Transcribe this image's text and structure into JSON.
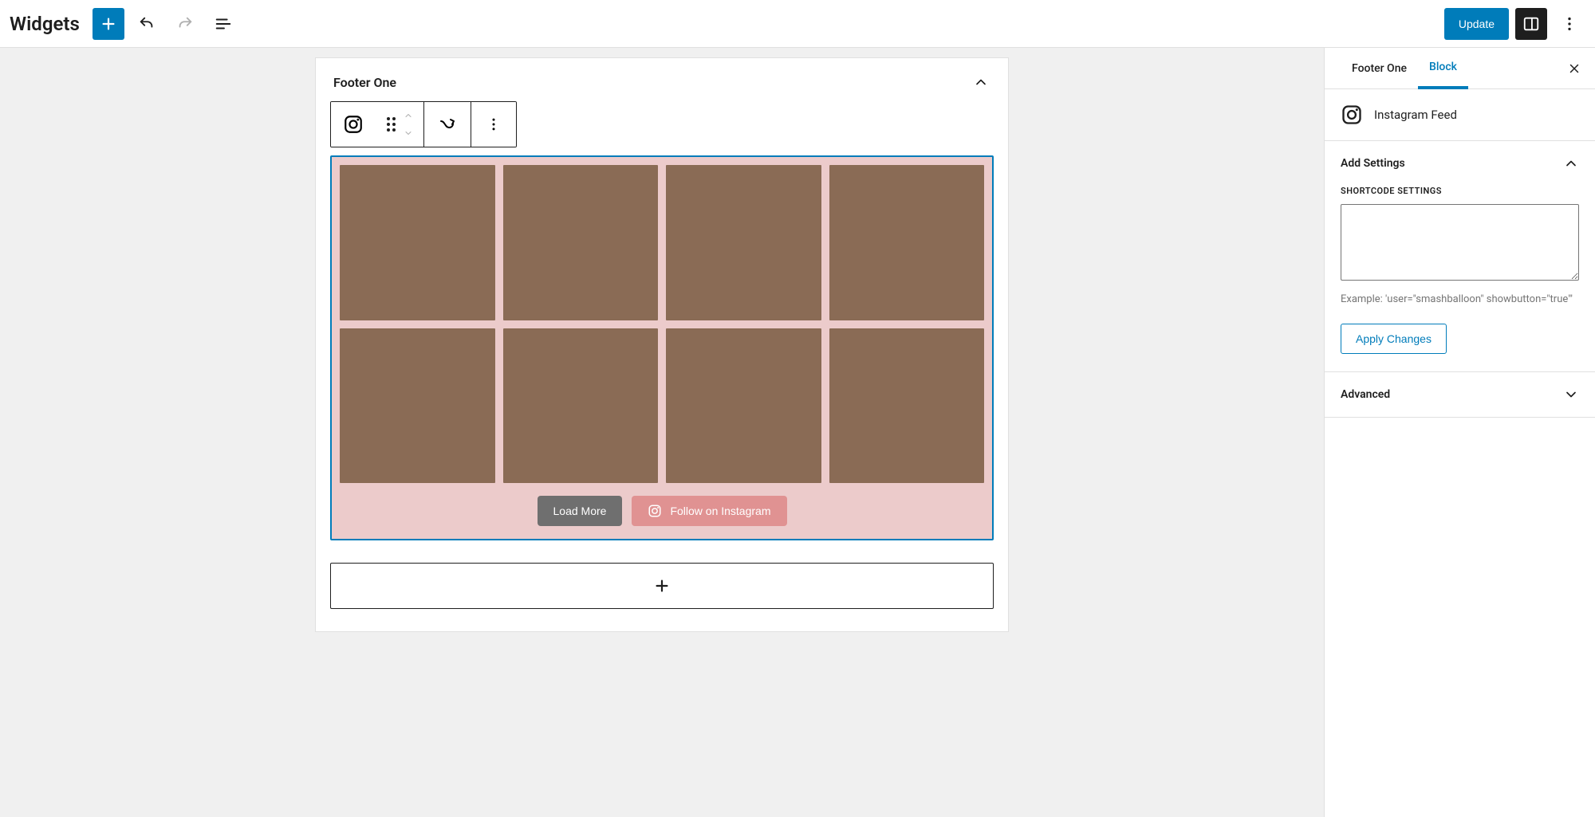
{
  "header": {
    "title": "Widgets",
    "update_label": "Update"
  },
  "editor": {
    "area_title": "Footer One",
    "feed": {
      "load_more_label": "Load More",
      "follow_label": "Follow on Instagram"
    }
  },
  "sidebar": {
    "tabs": {
      "area": "Footer One",
      "block": "Block"
    },
    "block_name": "Instagram Feed",
    "panels": {
      "settings": {
        "title": "Add Settings",
        "shortcode_label": "SHORTCODE SETTINGS",
        "shortcode_value": "",
        "example": "Example: 'user=\"smashballoon\" showbutton=\"true\"'",
        "apply_label": "Apply Changes"
      },
      "advanced": {
        "title": "Advanced"
      }
    }
  }
}
